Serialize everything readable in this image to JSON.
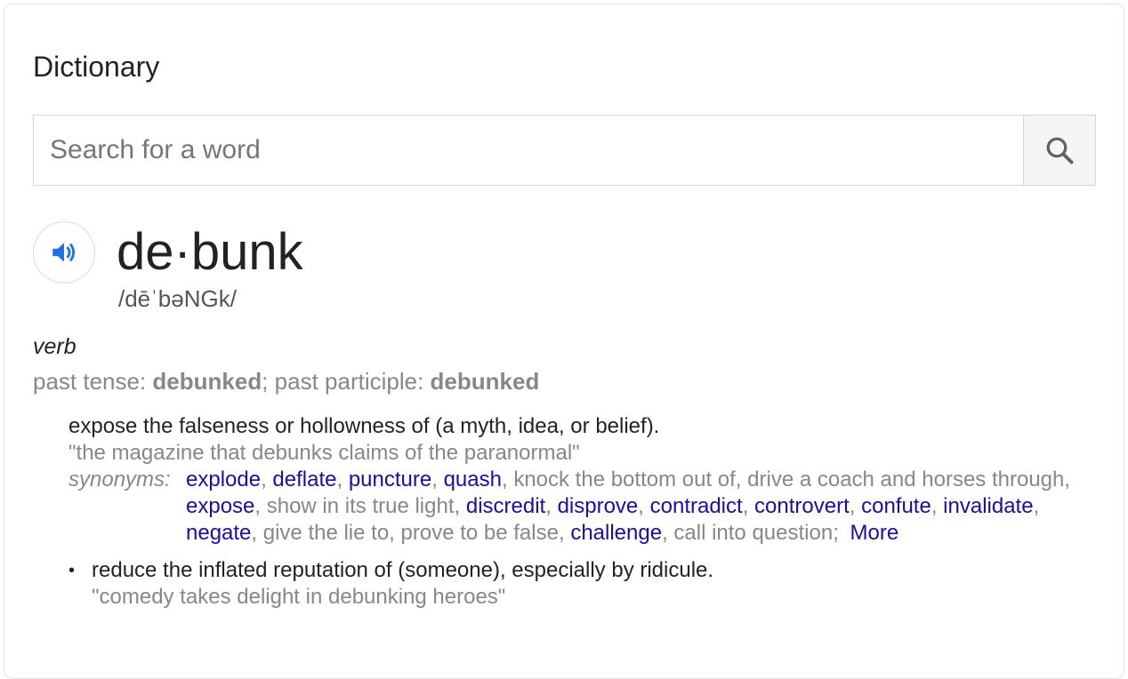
{
  "card": {
    "title": "Dictionary"
  },
  "search": {
    "placeholder": "Search for a word",
    "value": "",
    "button_icon": "search-icon"
  },
  "entry": {
    "speaker_icon": "speaker-icon",
    "headword": "de·bunk",
    "pronunciation": "/dēˈbəNGk/",
    "part_of_speech": "verb",
    "tense": {
      "past_label": "past tense: ",
      "past_value": "debunked",
      "sep": "; ",
      "participle_label": "past participle: ",
      "participle_value": "debunked"
    },
    "senses": [
      {
        "definition": "expose the falseness or hollowness of (a myth, idea, or belief).",
        "example": "\"the magazine that debunks claims of the paranormal\"",
        "synonyms_label": "synonyms:",
        "synonyms": [
          {
            "text": "explode",
            "link": true
          },
          {
            "text": "deflate",
            "link": true
          },
          {
            "text": "puncture",
            "link": true
          },
          {
            "text": "quash",
            "link": true
          },
          {
            "text": "knock the bottom out of",
            "link": false
          },
          {
            "text": "drive a coach and horses through",
            "link": false
          },
          {
            "text": "expose",
            "link": true
          },
          {
            "text": "show in its true light",
            "link": false
          },
          {
            "text": "discredit",
            "link": true
          },
          {
            "text": "disprove",
            "link": true
          },
          {
            "text": "contradict",
            "link": true
          },
          {
            "text": "controvert",
            "link": true
          },
          {
            "text": "confute",
            "link": true
          },
          {
            "text": "invalidate",
            "link": true
          },
          {
            "text": "negate",
            "link": true
          },
          {
            "text": "give the lie to",
            "link": false
          },
          {
            "text": "prove to be false",
            "link": false
          },
          {
            "text": "challenge",
            "link": true
          },
          {
            "text": "call into question",
            "link": false
          }
        ],
        "more_label": "More"
      },
      {
        "bullet": "•",
        "definition": "reduce the inflated reputation of (someone), especially by ridicule.",
        "example": "\"comedy takes delight in debunking heroes\""
      }
    ]
  },
  "colors": {
    "link": "#1a0dab",
    "muted": "#878787",
    "speaker": "#1a73e8"
  }
}
